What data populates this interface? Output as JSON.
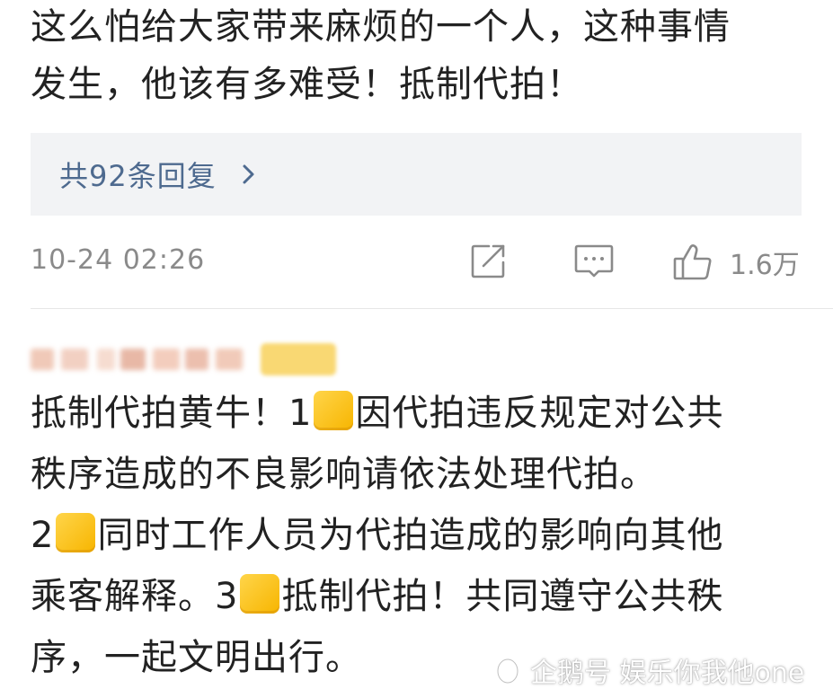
{
  "comment_top": {
    "line1": "这么怕给大家带来麻烦的一个人，这种事情",
    "line2": "发生，他该有多难受！抵制代拍！"
  },
  "replies": {
    "label": "共92条回复"
  },
  "meta": {
    "timestamp": "10-24 02:26",
    "like_count": "1.6万"
  },
  "comment_second": {
    "l1_a": "抵制代拍黄牛！1",
    "l1_b": "因代拍违反规定对公共",
    "l2": "秩序造成的不良影响请依法处理代拍。",
    "l3_a": "2",
    "l3_b": "同时工作人员为代拍造成的影响向其他",
    "l4_a": "乘客解释。3",
    "l4_b": "抵制代拍！共同遵守公共秩",
    "l5": "序，一起文明出行。"
  },
  "watermark": {
    "text": "企鹅号 娱乐你我他one"
  },
  "colors": {
    "link": "#4e6a8f",
    "meta_gray": "#8a8a8a",
    "reply_bg": "#f2f3f5",
    "emoji": "#f7b500"
  },
  "icons": [
    "chevron-right-icon",
    "share-icon",
    "comment-icon",
    "thumbs-up-icon",
    "penguin-logo-icon"
  ]
}
